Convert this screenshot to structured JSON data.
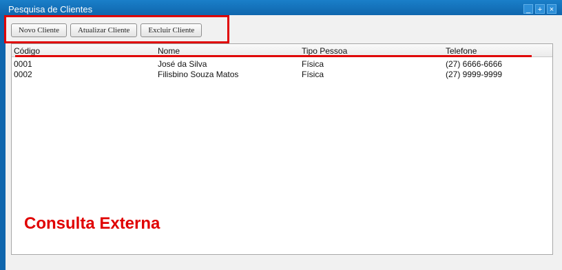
{
  "window": {
    "title": "Pesquisa de Clientes",
    "controls": [
      "_",
      "+",
      "×"
    ]
  },
  "toolbar": {
    "buttons": [
      {
        "label": "Novo Cliente"
      },
      {
        "label": "Atualizar Cliente"
      },
      {
        "label": "Excluir Cliente"
      }
    ]
  },
  "table": {
    "columns": [
      "Código",
      "Nome",
      "Tipo Pessoa",
      "Telefone"
    ],
    "rows": [
      [
        "0001",
        "José da Silva",
        "Física",
        "(27) 6666-6666"
      ],
      [
        "0002",
        "Filisbino Souza Matos",
        "Física",
        "(27) 9999-9999"
      ]
    ]
  },
  "annotation": {
    "label": "Consulta Externa",
    "color": "#e00000"
  }
}
